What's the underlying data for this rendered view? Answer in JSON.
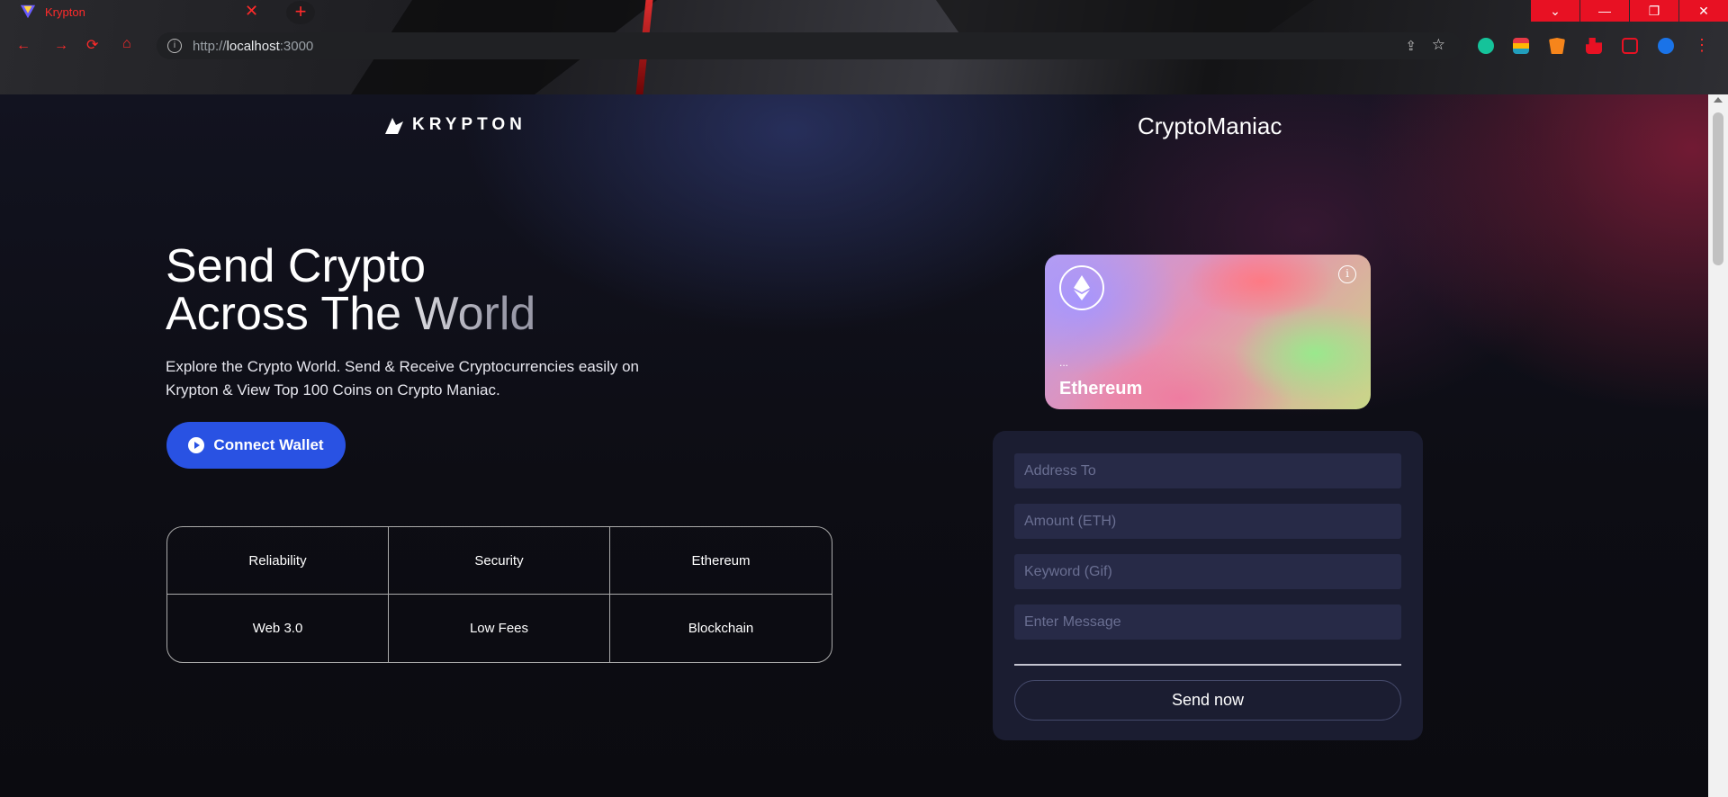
{
  "browser": {
    "tab_title": "Krypton",
    "tab_close_icon": "close-icon",
    "new_tab_icon": "plus-icon",
    "url_prefix": "http://",
    "url_host": "localhost",
    "url_port": ":3000",
    "window_controls": [
      "chevron-down-icon",
      "minimize-icon",
      "restore-icon",
      "close-icon"
    ],
    "extensions": [
      "grammarly-icon",
      "colorful-app-icon",
      "metamask-icon",
      "puzzle-icon",
      "sidebar-icon",
      "profile-avatar-icon"
    ],
    "accent_color": "#ff2a2a"
  },
  "header": {
    "logo_text": "KRYPTON",
    "right_link": "CryptoManiac"
  },
  "hero": {
    "title_line1": "Send Crypto",
    "title_line2": "Across The World",
    "subtitle": "Explore the Crypto World. Send & Receive Cryptocurrencies easily on Krypton & View Top 100 Coins on Crypto Maniac.",
    "connect_button": "Connect Wallet",
    "button_color": "#2952e3"
  },
  "features": [
    "Reliability",
    "Security",
    "Ethereum",
    "Web 3.0",
    "Low Fees",
    "Blockchain"
  ],
  "card": {
    "address": "...",
    "network": "Ethereum",
    "info_icon": "i"
  },
  "form": {
    "address_placeholder": "Address To",
    "amount_placeholder": "Amount (ETH)",
    "keyword_placeholder": "Keyword (Gif)",
    "message_placeholder": "Enter Message",
    "send_button": "Send now"
  }
}
